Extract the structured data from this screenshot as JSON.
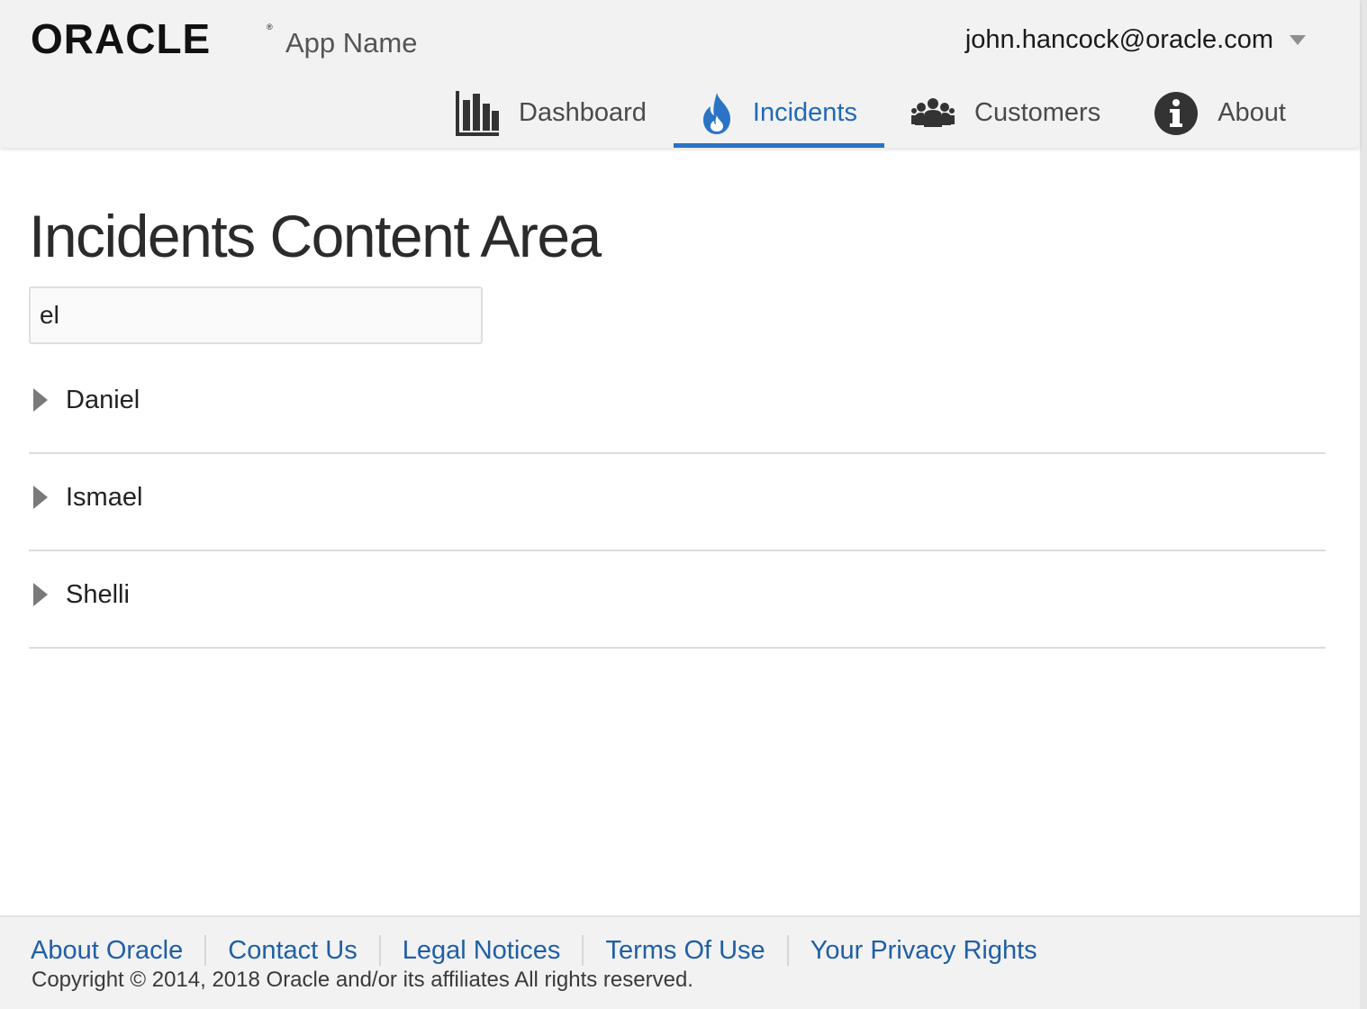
{
  "header": {
    "logo_text": "ORACLE",
    "app_name": "App Name",
    "user_email": "john.hancock@oracle.com"
  },
  "nav": {
    "items": [
      {
        "label": "Dashboard",
        "icon": "bar-chart-icon",
        "active": false
      },
      {
        "label": "Incidents",
        "icon": "fire-icon",
        "active": true
      },
      {
        "label": "Customers",
        "icon": "people-icon",
        "active": false
      },
      {
        "label": "About",
        "icon": "info-icon",
        "active": false
      }
    ],
    "active_color": "#2a73c5"
  },
  "main": {
    "title": "Incidents Content Area",
    "search_value": "el",
    "results": [
      {
        "name": "Daniel"
      },
      {
        "name": "Ismael"
      },
      {
        "name": "Shelli"
      }
    ]
  },
  "footer": {
    "links": [
      "About Oracle",
      "Contact Us",
      "Legal Notices",
      "Terms Of Use",
      "Your Privacy Rights"
    ],
    "copyright": "Copyright © 2014, 2018 Oracle and/or its affiliates All rights reserved.",
    "link_color": "#1f5fa6"
  }
}
